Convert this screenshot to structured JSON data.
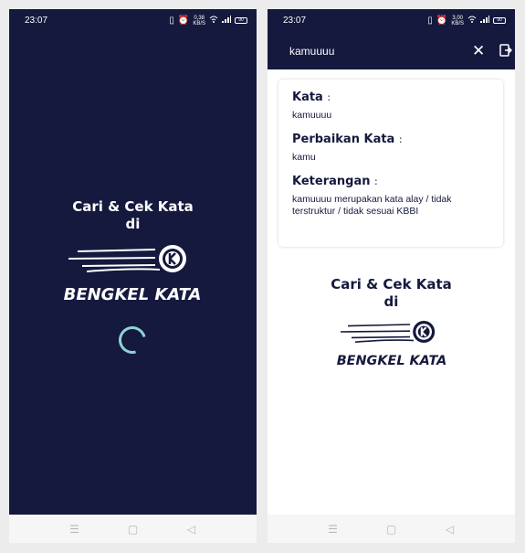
{
  "left_screen": {
    "status": {
      "time": "23:07",
      "speed_value": "0,38",
      "speed_unit": "KB/S",
      "battery": "90"
    },
    "tagline_line1": "Cari & Cek Kata",
    "tagline_line2": "di",
    "logo_text": "BENGKEL KATA",
    "nav": {
      "menu_icon": "menu-icon",
      "home_icon": "home-icon",
      "back_icon": "back-icon"
    }
  },
  "right_screen": {
    "status": {
      "time": "23:07",
      "speed_value": "3,00",
      "speed_unit": "KB/S",
      "battery": "90"
    },
    "search": {
      "value": "kamuuuu"
    },
    "result": {
      "kata_label": "Kata",
      "kata_value": "kamuuuu",
      "perbaikan_label": "Perbaikan Kata",
      "perbaikan_value": "kamu",
      "keterangan_label": "Keterangan",
      "keterangan_value": "kamuuuu merupakan kata alay / tidak terstruktur / tidak sesuai KBBI",
      "colon": ":"
    },
    "tagline_line1": "Cari & Cek Kata",
    "tagline_line2": "di",
    "logo_text": "BENGKEL KATA"
  },
  "colors": {
    "navy": "#15193e",
    "spinner": "#8ed3d6",
    "background": "#ececec"
  }
}
